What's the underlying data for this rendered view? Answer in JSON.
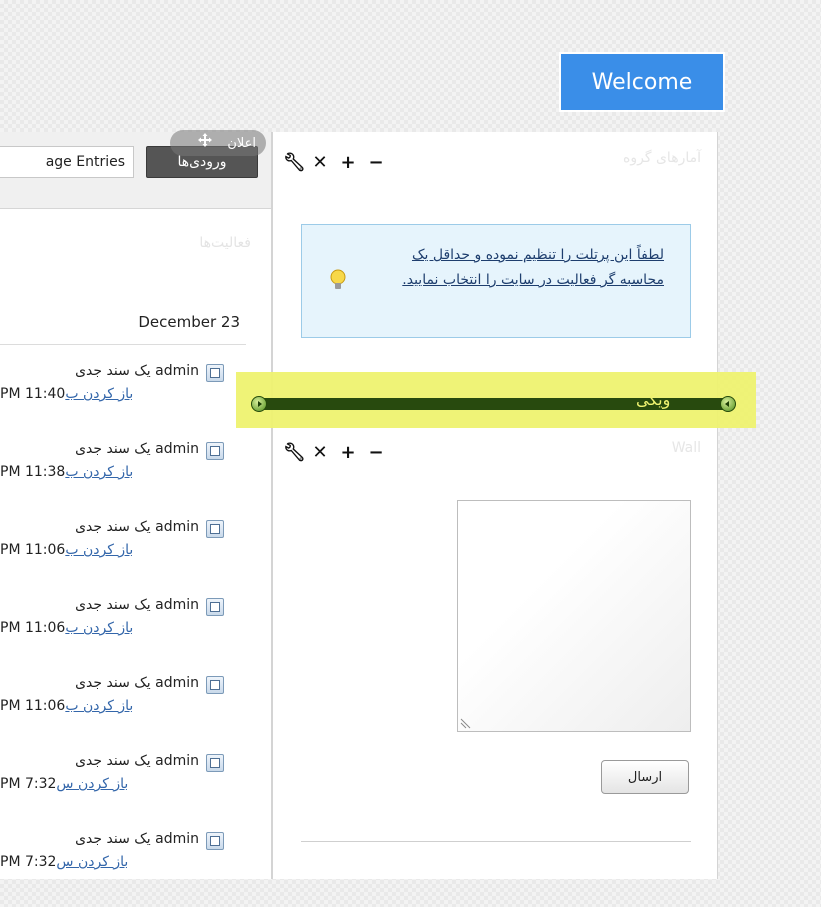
{
  "header": {
    "welcome": "Welcome"
  },
  "left_portlet": {
    "tab_entries": "age Entries",
    "tab_vorudi": "ورودی‌ها",
    "drag_label": "اعلان",
    "title": "فعالیت‌ها",
    "date_heading": "December 23",
    "activities": [
      {
        "user": "admin",
        "text": "یک سند جدی",
        "time": "PM 11:40",
        "link": "باز کردن ب"
      },
      {
        "user": "admin",
        "text": "یک سند جدی",
        "time": "PM 11:38",
        "link": "باز کردن ب"
      },
      {
        "user": "admin",
        "text": "یک سند جدی",
        "time": "PM 11:06",
        "link": "باز کردن ب"
      },
      {
        "user": "admin",
        "text": "یک سند جدی",
        "time": "PM 11:06",
        "link": "باز کردن ب"
      },
      {
        "user": "admin",
        "text": "یک سند جدی",
        "time": "PM 11:06",
        "link": "باز کردن ب"
      },
      {
        "user": "admin",
        "text": "یک سند جدی",
        "time": "PM 7:32",
        "link": "باز کردن س"
      },
      {
        "user": "admin",
        "text": "یک سند جدی",
        "time": "PM 7:32",
        "link": "باز کردن س"
      }
    ]
  },
  "stats_portlet": {
    "title": "آمارهای گروه",
    "message": "لطفاً این پرتلت را تنظیم نموده و حداقل یک محاسبه گر فعالیت در سایت را انتخاب نمایید."
  },
  "slider": {
    "label": "ویکی"
  },
  "wall_portlet": {
    "title": "Wall",
    "send_label": "ارسال"
  },
  "icons": [
    "wrench-icon",
    "close-icon",
    "plus-icon",
    "minus-icon",
    "bulb-icon",
    "move-icon",
    "document-icon"
  ],
  "colors": {
    "welcome_bg": "#3a8ee8",
    "highlight": "#eef270",
    "slider_bar": "#284a0e"
  }
}
